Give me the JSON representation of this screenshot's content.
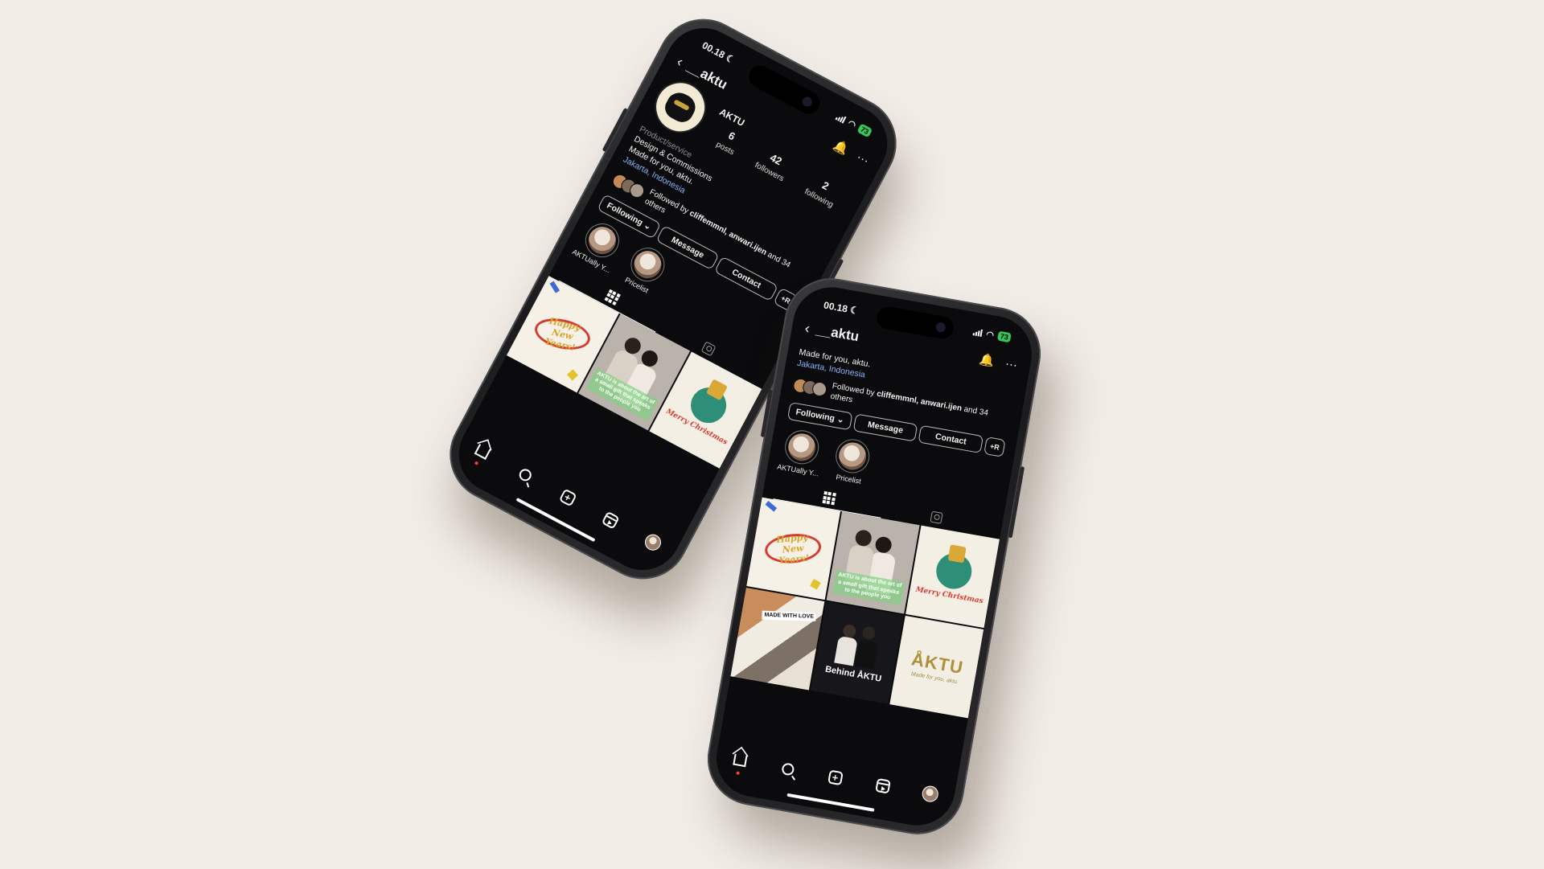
{
  "status": {
    "time": "00.18",
    "moon": "☾",
    "wifi": "◠",
    "battery": "73"
  },
  "profile": {
    "username": "__aktu",
    "back_icon": "‹",
    "bell_icon": "🔔",
    "more_icon": "···",
    "display_name": "AKTU",
    "posts_count": "6",
    "posts_label": "posts",
    "followers_count": "42",
    "followers_label": "followers",
    "following_count": "2",
    "following_label": "following",
    "category": "Product/service",
    "bio_line1": "Design & Commissions",
    "bio_line2": "Made for you, aktu.",
    "location": "Jakarta, Indonesia",
    "followed_prefix": "Followed by ",
    "followed_names": "cliffemmnl, anwari.ijen",
    "followed_suffix": " and 34 others"
  },
  "actions": {
    "following_label": "Following",
    "following_caret": "⌄",
    "message_label": "Message",
    "contact_label": "Contact",
    "add_person_label": "+R"
  },
  "highlights": [
    {
      "label": "AKTUally Y..."
    },
    {
      "label": "Pricelist"
    }
  ],
  "posts": {
    "newyear_text": "Happy New Years!",
    "couple_caption": "AKTU is about the art of a small gift that speaks to the people you",
    "xmas_text": "Merry Christmas",
    "collage_text": "MADE WITH LOVE",
    "behind_text": "Behind ÅKTU",
    "brand_word": "ÅKTU",
    "brand_sub": "Made for you, aktu."
  },
  "nav": {
    "add_symbol": "+"
  },
  "colors": {
    "background": "#f2ede7",
    "screen": "#0b0b0d",
    "battery": "#34c759",
    "link": "#8ab4f8",
    "notification_dot": "#ff3b30"
  }
}
